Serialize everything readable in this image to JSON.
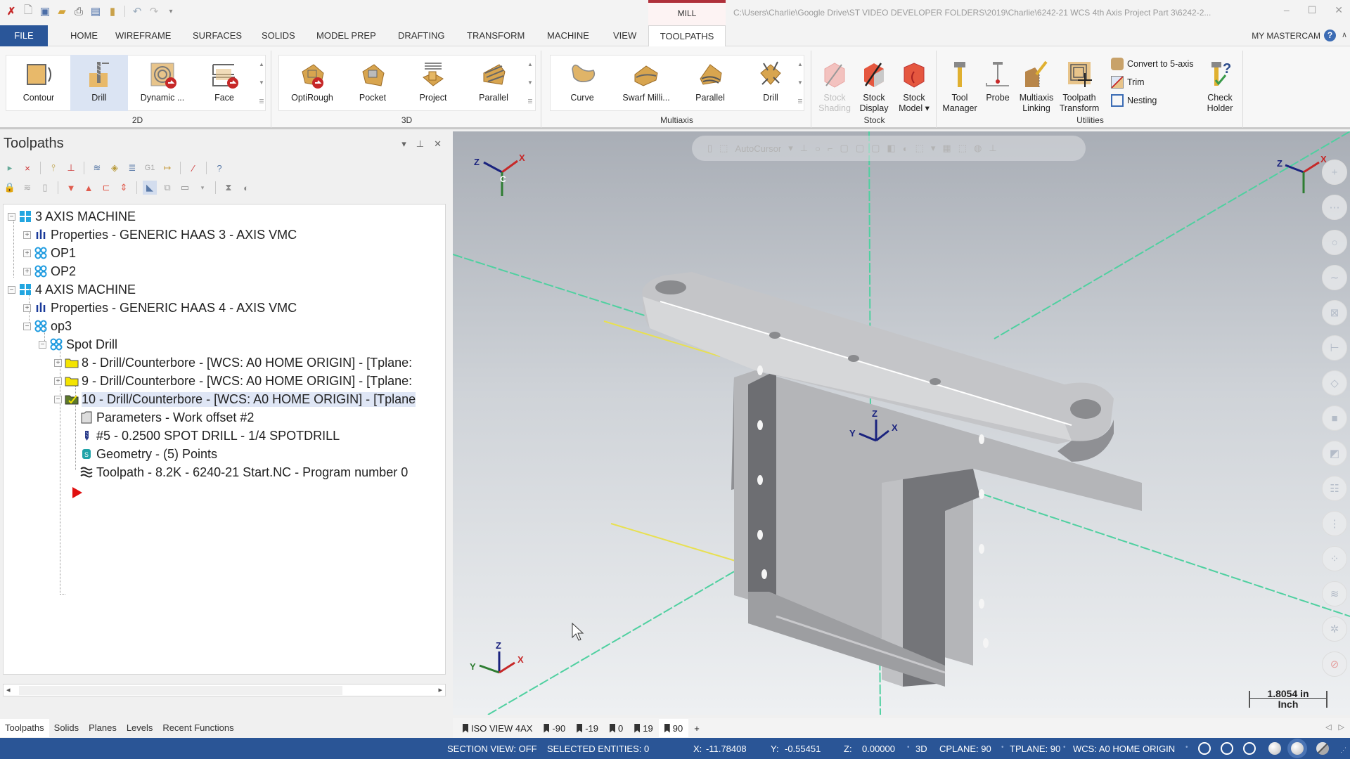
{
  "window": {
    "context_tab": "MILL",
    "title_path": "C:\\Users\\Charlie\\Google Drive\\ST VIDEO DEVELOPER FOLDERS\\2019\\Charlie\\6242-21 WCS 4th Axis Project Part 3\\6242-2...",
    "minimize": "–",
    "maximize": "☐",
    "close": "✕"
  },
  "quick_access": [
    "app-logo",
    "new-file",
    "save",
    "open",
    "print",
    "save-as",
    "folder",
    "undo",
    "redo",
    "customize"
  ],
  "ribbon_tabs": [
    {
      "label": "FILE"
    },
    {
      "label": "HOME"
    },
    {
      "label": "WIREFRAME"
    },
    {
      "label": "SURFACES"
    },
    {
      "label": "SOLIDS"
    },
    {
      "label": "MODEL PREP"
    },
    {
      "label": "DRAFTING"
    },
    {
      "label": "TRANSFORM"
    },
    {
      "label": "MACHINE"
    },
    {
      "label": "VIEW"
    },
    {
      "label": "TOOLPATHS",
      "active": true
    }
  ],
  "my_mastercam": "MY MASTERCAM",
  "help": "?",
  "ribbon": {
    "groups": {
      "g2d": "2D",
      "g3d": "3D",
      "multiaxis": "Multiaxis",
      "stock": "Stock",
      "utilities": "Utilities"
    },
    "buttons_2d": [
      "Contour",
      "Drill",
      "Dynamic ...",
      "Face"
    ],
    "selected_2d": "Drill",
    "buttons_3d": [
      "OptiRough",
      "Pocket",
      "Project",
      "Parallel"
    ],
    "buttons_multiaxis": [
      "Curve",
      "Swarf Milli...",
      "Parallel",
      "Drill"
    ],
    "stock": {
      "shading": [
        "Stock",
        "Shading"
      ],
      "display": [
        "Stock",
        "Display"
      ],
      "model": [
        "Stock",
        "Model ▾"
      ]
    },
    "utilities": {
      "tool_manager": [
        "Tool",
        "Manager"
      ],
      "probe": [
        "Probe"
      ],
      "multiaxis_linking": [
        "Multiaxis",
        "Linking"
      ],
      "toolpath_transform": [
        "Toolpath",
        "Transform"
      ],
      "convert": "Convert to 5-axis",
      "trim": "Trim",
      "nesting": "Nesting",
      "check_holder": [
        "Check",
        "Holder"
      ]
    }
  },
  "panel": {
    "title": "Toolpaths",
    "tree": [
      {
        "label": "3 AXIS MACHINE",
        "icon": "machine-group",
        "level": 0,
        "expander": "−"
      },
      {
        "label": "Properties - GENERIC HAAS 3 - AXIS VMC",
        "icon": "properties",
        "level": 1,
        "expander": "+"
      },
      {
        "label": "OP1",
        "icon": "toolpath-group",
        "level": 1,
        "expander": "+"
      },
      {
        "label": "OP2",
        "icon": "toolpath-group",
        "level": 1,
        "expander": "+"
      },
      {
        "label": "4 AXIS MACHINE",
        "icon": "machine-group",
        "level": 0,
        "expander": "−"
      },
      {
        "label": "Properties - GENERIC HAAS 4 - AXIS VMC",
        "icon": "properties",
        "level": 1,
        "expander": "+"
      },
      {
        "label": "op3",
        "icon": "toolpath-group",
        "level": 1,
        "expander": "−"
      },
      {
        "label": "Spot Drill",
        "icon": "toolpath-group",
        "level": 2,
        "expander": "−"
      },
      {
        "label": "8 - Drill/Counterbore - [WCS: A0 HOME ORIGIN] - [Tplane:",
        "icon": "folder",
        "level": 3,
        "expander": "+"
      },
      {
        "label": "9 - Drill/Counterbore - [WCS: A0 HOME ORIGIN] - [Tplane:",
        "icon": "folder",
        "level": 3,
        "expander": "+"
      },
      {
        "label": "10 - Drill/Counterbore - [WCS: A0 HOME ORIGIN] - [Tplane",
        "icon": "folder-open",
        "level": 3,
        "expander": "−",
        "selected": true
      },
      {
        "label": "Parameters - Work offset #2",
        "icon": "parameters",
        "level": 4
      },
      {
        "label": "#5 - 0.2500 SPOT DRILL - 1/4 SPOTDRILL",
        "icon": "tool",
        "level": 4
      },
      {
        "label": "Geometry - (5) Points",
        "icon": "geometry",
        "level": 4
      },
      {
        "label": "Toolpath - 8.2K - 6240-21 Start.NC - Program number 0",
        "icon": "toolpath",
        "level": 4
      }
    ],
    "insert_arrow": "insert-arrow",
    "bottom_tabs": [
      "Toolpaths",
      "Solids",
      "Planes",
      "Levels",
      "Recent Functions"
    ]
  },
  "viewport": {
    "autocursor": "AutoCursor",
    "gnomon_labels": {
      "x": "X",
      "y": "Y",
      "z": "Z",
      "c": "C"
    },
    "scale_value": "1.8054 in",
    "scale_unit": "Inch",
    "view_tabs": [
      {
        "label": "ISO VIEW 4AX"
      },
      {
        "label": "-90"
      },
      {
        "label": "-19"
      },
      {
        "label": "0"
      },
      {
        "label": "19"
      },
      {
        "label": "90",
        "active": true
      }
    ],
    "add_tab": "+"
  },
  "status": {
    "section_view": "SECTION VIEW: OFF",
    "selected": "SELECTED ENTITIES: 0",
    "x_label": "X:",
    "x_value": "-11.78408",
    "y_label": "Y:",
    "y_value": "-0.55451",
    "z_label": "Z:",
    "z_value": "0.00000",
    "mode": "3D",
    "cplane": "CPLANE: 90",
    "tplane": "TPLANE: 90",
    "wcs": "WCS: A0 HOME ORIGIN"
  },
  "colors": {
    "file_tab": "#2a5699",
    "status_bar": "#2a5596",
    "mill_accent": "#b0303a",
    "axis_x": "#c62828",
    "axis_y": "#2e7d32",
    "axis_z": "#1a237e"
  }
}
